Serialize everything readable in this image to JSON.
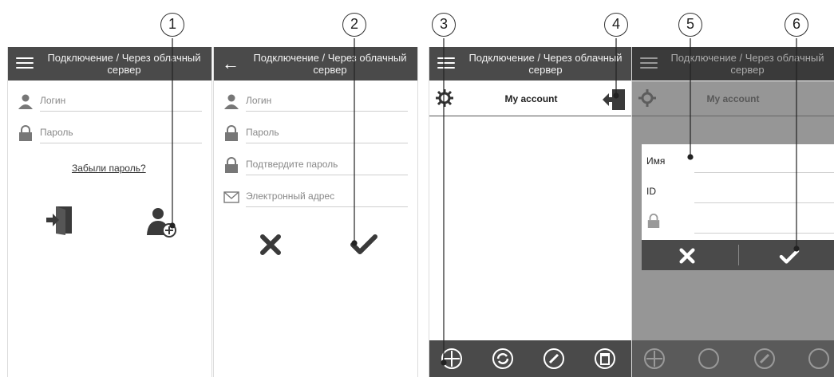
{
  "header": {
    "title": "Подключение / Через облачный сервер"
  },
  "login": {
    "login_placeholder": "Логин",
    "password_placeholder": "Пароль",
    "forgot_link": "Забыли пароль?"
  },
  "register": {
    "login_placeholder": "Логин",
    "password_placeholder": "Пароль",
    "confirm_placeholder": "Подтвердите пароль",
    "email_placeholder": "Электронный адрес"
  },
  "account": {
    "title": "My account"
  },
  "dialog": {
    "name_label": "Имя",
    "id_label": "ID"
  },
  "callouts": [
    "1",
    "2",
    "3",
    "4",
    "5",
    "6"
  ],
  "colors": {
    "bar": "#4a4a4a",
    "overlay": "#6e6e6e",
    "icon": "#3a3a3a"
  }
}
